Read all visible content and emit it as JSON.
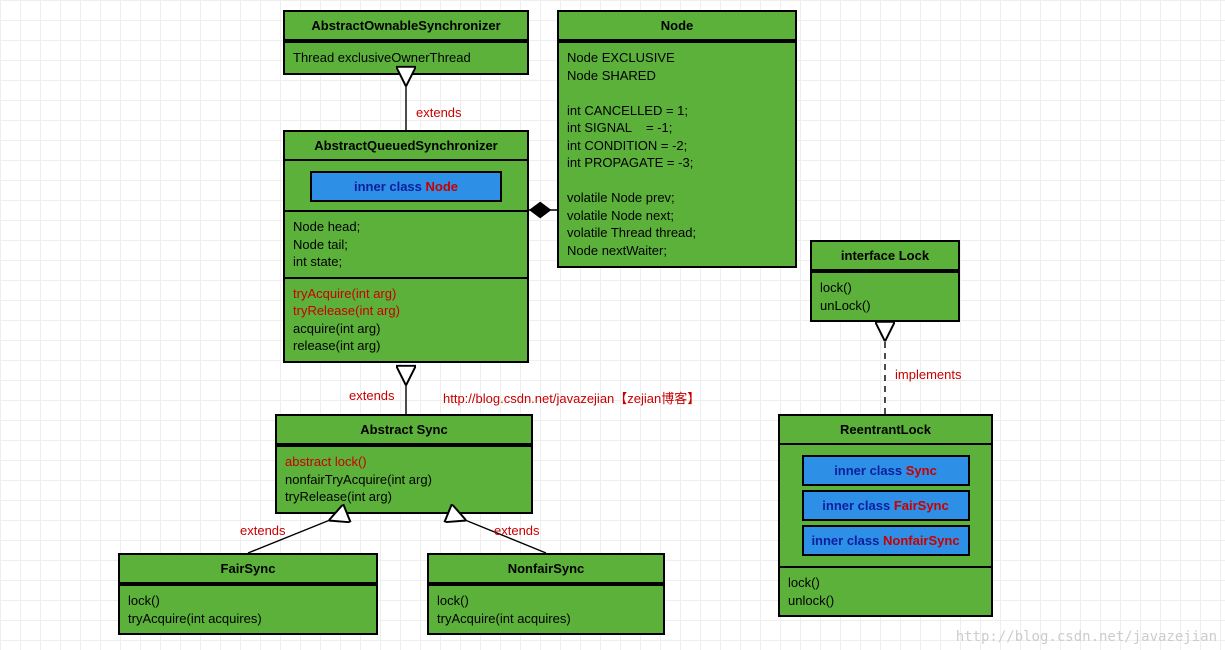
{
  "aos": {
    "title": "AbstractOwnableSynchronizer",
    "field": "Thread exclusiveOwnerThread"
  },
  "aqs": {
    "title": "AbstractQueuedSynchronizer",
    "inner": {
      "prefix": "inner class ",
      "name": "Node"
    },
    "fields": "Node head;\nNode tail;\nint state;",
    "m_red": "tryAcquire(int arg)\ntryRelease(int arg)",
    "m_blk": "acquire(int arg)\nrelease(int arg)"
  },
  "node": {
    "title": "Node",
    "body": "Node EXCLUSIVE\nNode SHARED\n\nint CANCELLED = 1;\nint SIGNAL    = -1;\nint CONDITION = -2;\nint PROPAGATE = -3;\n\nvolatile Node prev;\nvolatile Node next;\nvolatile Thread thread;\nNode nextWaiter;"
  },
  "lock": {
    "title": "interface Lock",
    "body": "lock()\nunLock()"
  },
  "sync": {
    "title": "Abstract Sync",
    "m_red": "abstract lock()",
    "m_blk": "nonfairTryAcquire(int arg)\ntryRelease(int arg)"
  },
  "fair": {
    "title": "FairSync",
    "body": "lock()\ntryAcquire(int acquires)"
  },
  "nfair": {
    "title": "NonfairSync",
    "body": "lock()\ntryAcquire(int acquires)"
  },
  "reent": {
    "title": "ReentrantLock",
    "i1": {
      "p": "inner class ",
      "n": "Sync"
    },
    "i2": {
      "p": "inner class ",
      "n": "FairSync"
    },
    "i3": {
      "p": "inner class ",
      "n": "NonfairSync"
    },
    "body": "lock()\nunlock()"
  },
  "lbl": {
    "ext": "extends",
    "impl": "implements"
  },
  "credit": "http://blog.csdn.net/javazejian【zejian博客】",
  "watermark": "http://blog.csdn.net/javazejian"
}
